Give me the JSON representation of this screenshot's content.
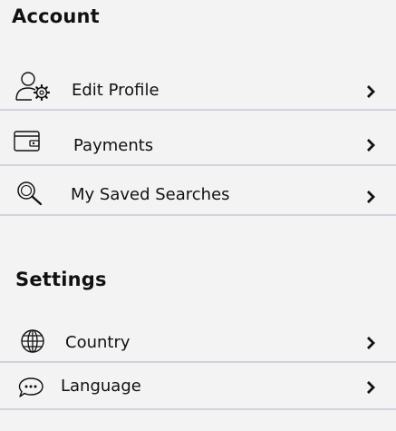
{
  "account": {
    "title": "Account",
    "items": [
      {
        "label": "Edit Profile",
        "icon": "user-gear-icon"
      },
      {
        "label": "Payments",
        "icon": "wallet-icon"
      },
      {
        "label": "My Saved Searches",
        "icon": "search-icon"
      }
    ]
  },
  "settings": {
    "title": "Settings",
    "items": [
      {
        "label": "Country",
        "icon": "globe-icon"
      },
      {
        "label": "Language",
        "icon": "speech-bubble-icon"
      }
    ]
  },
  "colors": {
    "background": "#f3f3f3",
    "divider": "#cfd4dc",
    "text": "#111111"
  }
}
